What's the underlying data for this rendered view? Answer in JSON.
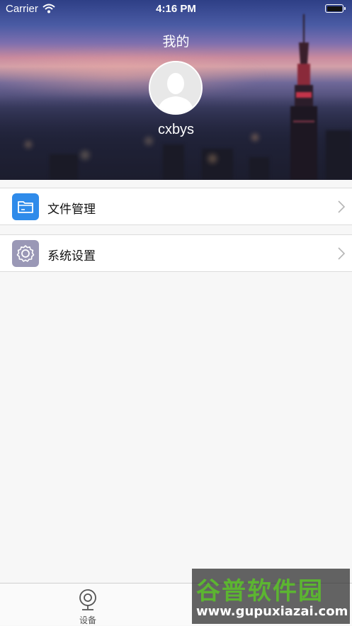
{
  "status_bar": {
    "carrier": "Carrier",
    "time": "4:16 PM"
  },
  "header": {
    "title": "我的",
    "username": "cxbys"
  },
  "menu": [
    {
      "label": "文件管理",
      "icon": "folder-icon",
      "icon_bg": "#2f8bea"
    },
    {
      "label": "系统设置",
      "icon": "gear-icon",
      "icon_bg": "#9a98b6"
    }
  ],
  "tabbar": {
    "items": [
      {
        "label": "设备",
        "icon": "camera-icon"
      }
    ]
  },
  "watermark": {
    "title": "谷普软件园",
    "url": "www.gupuxiazai.com"
  },
  "colors": {
    "background": "#f7f7f7",
    "watermark_green": "#5cb531"
  }
}
